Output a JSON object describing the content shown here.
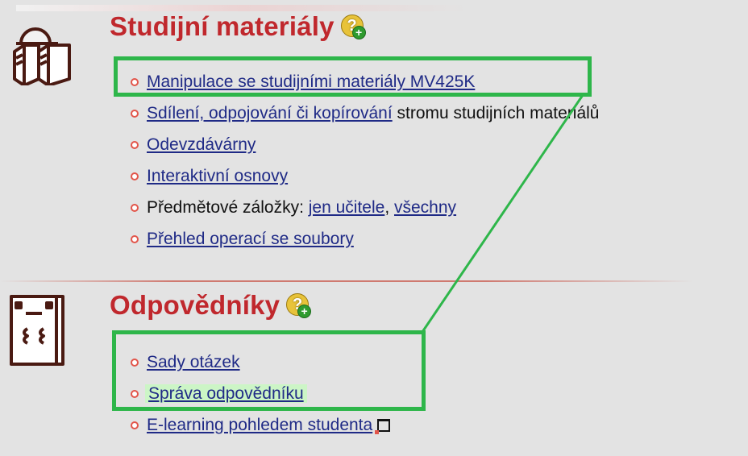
{
  "sections": {
    "materials": {
      "title": "Studijní materiály",
      "help_glyph": "?",
      "add_glyph": "+",
      "items": {
        "manipulace": "Manipulace se studijními materiály MV425K",
        "sdileni_link": "Sdílení, odpojování či kopírování",
        "sdileni_rest": " stromu studijních materiálů",
        "odevzdavarny": "Odevzdávárny",
        "osnovy": "Interaktivní osnovy",
        "zalozky_label": "Předmětové záložky: ",
        "zalozky_ucitele": "jen učitele",
        "zalozky_sep": ", ",
        "zalozky_vsechny": "všechny",
        "prehled": "Přehled operací se soubory"
      },
      "icon": "book-stand-icon"
    },
    "responders": {
      "title": "Odpovědníky",
      "help_glyph": "?",
      "add_glyph": "+",
      "items": {
        "sady": "Sady otázek",
        "sprava": "Správa odpovědníku",
        "elearning": "E-learning pohledem studenta"
      },
      "icon": "answer-sheet-icon"
    }
  },
  "colors": {
    "heading": "#c0282d",
    "link": "#1f2a86",
    "annotation": "#2eb64a",
    "highlight": "#ccf5c6",
    "background": "#e3e3e3"
  }
}
